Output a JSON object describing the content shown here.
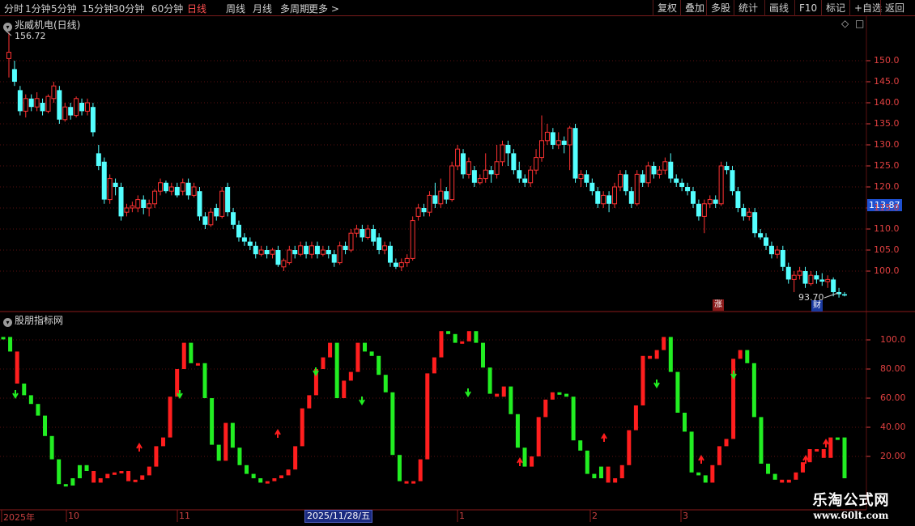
{
  "toolbar": {
    "left_items": [
      "分时",
      "1分钟",
      "5分钟",
      "15分钟",
      "30分钟",
      "60分钟",
      "日线",
      "周线",
      "月线",
      "多周期",
      "更多 >"
    ],
    "active": "日线",
    "right_items": [
      "复权",
      "叠加",
      "多股",
      "统计",
      "画线",
      "F10",
      "标记",
      "+自选",
      "返回"
    ]
  },
  "main_panel": {
    "title": "兆威机电(日线)",
    "high_label": "156.72",
    "low_label": "93.70",
    "price_tag": "113.87",
    "badge_up": "涨",
    "badge_cai": "财",
    "y_ticks": [
      "150.0",
      "145.0",
      "140.0",
      "135.0",
      "130.0",
      "125.0",
      "120.0",
      "115.0",
      "110.0",
      "105.0",
      "100.0"
    ]
  },
  "indicator_panel": {
    "title": "股朋指标网",
    "y_ticks": [
      "100.0",
      "80.00",
      "60.00",
      "40.00",
      "20.00"
    ]
  },
  "date_axis": {
    "labels": [
      "2025年",
      "10",
      "11",
      "1",
      "2",
      "3"
    ],
    "selected": "2025/11/28/五"
  },
  "watermark": {
    "title": "乐淘公式网",
    "url": "www.60lt.com"
  },
  "colors": {
    "up": "#ff3232",
    "down": "#54ffff",
    "ind_up": "#ff1e1e",
    "ind_down": "#22ee22",
    "grid": "#5a1010",
    "axis_text": "#e04040"
  },
  "chart_data": {
    "type": "candlestick",
    "candles": [
      [
        150.5,
        152.0,
        146.0,
        156.7
      ],
      [
        148.0,
        145.0,
        144.0,
        150.0
      ],
      [
        143.0,
        138.0,
        137.0,
        144.0
      ],
      [
        138.0,
        141.0,
        136.5,
        142.0
      ],
      [
        141.0,
        139.0,
        138.0,
        142.0
      ],
      [
        139.0,
        141.0,
        138.0,
        142.5
      ],
      [
        140.0,
        138.0,
        137.0,
        141.0
      ],
      [
        138.0,
        141.5,
        137.5,
        142.0
      ],
      [
        141.0,
        144.0,
        140.0,
        145.0
      ],
      [
        143.0,
        136.0,
        135.0,
        144.0
      ],
      [
        136.0,
        139.0,
        135.5,
        140.0
      ],
      [
        139.0,
        137.0,
        136.0,
        140.0
      ],
      [
        137.0,
        141.0,
        136.5,
        141.5
      ],
      [
        140.0,
        138.0,
        137.0,
        141.0
      ],
      [
        138.0,
        140.0,
        137.0,
        141.0
      ],
      [
        139.0,
        133.0,
        132.0,
        140.0
      ],
      [
        128.0,
        125.0,
        124.0,
        130.0
      ],
      [
        126.0,
        117.0,
        116.0,
        127.0
      ],
      [
        117.0,
        122.0,
        116.0,
        123.0
      ],
      [
        121.0,
        120.0,
        118.0,
        122.0
      ],
      [
        120.0,
        113.0,
        112.0,
        121.0
      ],
      [
        114.0,
        115.0,
        113.0,
        116.0
      ],
      [
        115.0,
        115.5,
        114.0,
        116.5
      ],
      [
        115.0,
        117.0,
        114.0,
        118.0
      ],
      [
        117.0,
        115.0,
        113.5,
        118.0
      ],
      [
        115.0,
        116.0,
        113.0,
        117.0
      ],
      [
        116.0,
        119.0,
        115.0,
        119.5
      ],
      [
        119.0,
        121.0,
        118.0,
        122.0
      ],
      [
        121.0,
        119.0,
        118.5,
        121.5
      ],
      [
        119.0,
        120.0,
        118.0,
        121.0
      ],
      [
        120.0,
        118.0,
        117.5,
        121.0
      ],
      [
        119.0,
        121.0,
        118.0,
        122.0
      ],
      [
        121.0,
        118.0,
        117.0,
        122.0
      ],
      [
        118.0,
        120.0,
        117.5,
        121.0
      ],
      [
        119.0,
        113.0,
        112.0,
        120.0
      ],
      [
        113.0,
        111.0,
        110.0,
        114.0
      ],
      [
        111.0,
        114.0,
        110.5,
        115.0
      ],
      [
        115.0,
        113.0,
        112.0,
        116.0
      ],
      [
        113.0,
        119.0,
        112.5,
        120.0
      ],
      [
        120.0,
        114.0,
        113.0,
        121.0
      ],
      [
        114.0,
        111.0,
        110.0,
        115.0
      ],
      [
        111.0,
        108.0,
        107.0,
        112.0
      ],
      [
        108.0,
        107.0,
        106.0,
        109.0
      ],
      [
        107.0,
        106.0,
        105.0,
        108.0
      ],
      [
        106.0,
        104.0,
        103.0,
        107.0
      ],
      [
        104.0,
        105.0,
        103.5,
        106.0
      ],
      [
        105.0,
        104.0,
        103.0,
        106.0
      ],
      [
        104.0,
        105.0,
        103.0,
        105.5
      ],
      [
        105.0,
        101.5,
        101.0,
        106.0
      ],
      [
        101.0,
        102.5,
        100.0,
        103.0
      ],
      [
        102.0,
        105.0,
        101.5,
        106.0
      ],
      [
        105.0,
        104.0,
        103.0,
        106.0
      ],
      [
        104.0,
        106.0,
        103.5,
        107.0
      ],
      [
        106.0,
        104.0,
        103.0,
        107.0
      ],
      [
        104.0,
        106.0,
        103.0,
        107.0
      ],
      [
        106.0,
        104.0,
        103.0,
        107.0
      ],
      [
        104.0,
        105.0,
        103.5,
        106.0
      ],
      [
        105.0,
        104.0,
        103.0,
        106.0
      ],
      [
        104.0,
        102.0,
        101.0,
        105.0
      ],
      [
        102.0,
        106.0,
        101.5,
        107.0
      ],
      [
        106.0,
        105.0,
        104.0,
        107.0
      ],
      [
        105.0,
        109.0,
        104.5,
        110.0
      ],
      [
        109.0,
        110.0,
        108.0,
        111.0
      ],
      [
        110.0,
        108.0,
        107.0,
        111.0
      ],
      [
        108.0,
        110.0,
        107.5,
        111.0
      ],
      [
        110.0,
        107.0,
        106.0,
        111.0
      ],
      [
        108.0,
        105.0,
        104.0,
        109.0
      ],
      [
        105.0,
        106.0,
        104.0,
        107.0
      ],
      [
        106.0,
        102.0,
        101.0,
        107.0
      ],
      [
        102.0,
        101.0,
        100.5,
        103.0
      ],
      [
        101.0,
        102.0,
        100.0,
        103.0
      ],
      [
        102.0,
        103.0,
        101.0,
        104.0
      ],
      [
        103.0,
        112.0,
        102.5,
        113.0
      ],
      [
        113.0,
        115.0,
        112.0,
        116.0
      ],
      [
        115.0,
        114.0,
        113.0,
        116.0
      ],
      [
        114.0,
        118.0,
        113.0,
        119.0
      ],
      [
        118.0,
        116.0,
        115.0,
        121.0
      ],
      [
        116.0,
        119.0,
        115.0,
        122.0
      ],
      [
        119.0,
        117.0,
        116.0,
        120.0
      ],
      [
        117.0,
        125.0,
        116.5,
        126.0
      ],
      [
        125.0,
        129.0,
        124.0,
        130.0
      ],
      [
        128.0,
        123.0,
        122.0,
        129.0
      ],
      [
        123.0,
        126.0,
        122.0,
        127.0
      ],
      [
        124.0,
        121.0,
        120.0,
        125.0
      ],
      [
        121.0,
        122.0,
        120.5,
        123.0
      ],
      [
        122.0,
        124.0,
        121.0,
        128.0
      ],
      [
        124.0,
        123.0,
        121.0,
        125.0
      ],
      [
        123.0,
        126.0,
        122.0,
        130.0
      ],
      [
        126.0,
        130.0,
        125.0,
        131.0
      ],
      [
        130.0,
        128.0,
        125.0,
        131.0
      ],
      [
        128.0,
        124.0,
        123.0,
        129.0
      ],
      [
        124.0,
        122.0,
        121.0,
        126.0
      ],
      [
        122.0,
        121.0,
        120.0,
        123.0
      ],
      [
        121.0,
        124.0,
        120.0,
        125.0
      ],
      [
        124.0,
        127.0,
        123.0,
        129.0
      ],
      [
        127.0,
        131.0,
        126.0,
        137.0
      ],
      [
        131.0,
        133.0,
        130.0,
        135.0
      ],
      [
        133.0,
        130.0,
        129.0,
        134.0
      ],
      [
        130.0,
        131.0,
        129.0,
        133.0
      ],
      [
        131.0,
        130.0,
        128.0,
        132.0
      ],
      [
        130.0,
        134.0,
        124.0,
        134.5
      ],
      [
        134.0,
        122.0,
        121.0,
        135.0
      ],
      [
        122.0,
        123.0,
        120.0,
        124.0
      ],
      [
        123.0,
        121.0,
        120.0,
        124.0
      ],
      [
        121.0,
        119.0,
        118.0,
        122.0
      ],
      [
        119.0,
        116.0,
        115.0,
        120.0
      ],
      [
        116.0,
        118.0,
        115.0,
        119.0
      ],
      [
        118.0,
        116.0,
        114.0,
        119.0
      ],
      [
        116.0,
        120.0,
        115.0,
        121.0
      ],
      [
        120.0,
        123.0,
        119.0,
        124.0
      ],
      [
        123.0,
        119.0,
        118.0,
        124.0
      ],
      [
        119.0,
        116.0,
        115.0,
        120.0
      ],
      [
        116.0,
        123.0,
        115.5,
        124.0
      ],
      [
        123.0,
        121.0,
        120.0,
        124.0
      ],
      [
        121.0,
        125.0,
        120.0,
        126.0
      ],
      [
        125.0,
        123.0,
        122.0,
        126.0
      ],
      [
        123.0,
        124.0,
        122.0,
        125.0
      ],
      [
        124.0,
        126.0,
        123.0,
        127.0
      ],
      [
        126.0,
        122.0,
        121.0,
        128.0
      ],
      [
        122.0,
        121.0,
        120.0,
        123.0
      ],
      [
        121.0,
        120.0,
        119.0,
        122.0
      ],
      [
        120.0,
        119.0,
        118.0,
        121.0
      ],
      [
        119.0,
        116.0,
        115.0,
        120.0
      ],
      [
        116.0,
        113.0,
        112.0,
        117.0
      ],
      [
        113.0,
        116.0,
        109.0,
        117.0
      ],
      [
        116.0,
        117.0,
        115.0,
        118.0
      ],
      [
        117.0,
        116.0,
        115.0,
        118.0
      ],
      [
        116.0,
        125.0,
        115.5,
        126.0
      ],
      [
        125.0,
        124.0,
        123.0,
        126.0
      ],
      [
        124.0,
        119.0,
        118.0,
        125.0
      ],
      [
        119.0,
        115.0,
        114.0,
        120.0
      ],
      [
        115.0,
        113.0,
        112.0,
        116.0
      ],
      [
        113.0,
        114.0,
        112.0,
        115.0
      ],
      [
        114.0,
        109.0,
        108.0,
        115.0
      ],
      [
        109.0,
        108.0,
        107.5,
        110.0
      ],
      [
        108.0,
        106.0,
        105.0,
        109.0
      ],
      [
        106.0,
        104.0,
        103.0,
        107.0
      ],
      [
        104.0,
        105.0,
        103.0,
        106.0
      ],
      [
        105.0,
        101.0,
        100.0,
        106.0
      ],
      [
        101.0,
        98.0,
        97.0,
        102.0
      ],
      [
        98.0,
        99.0,
        95.0,
        100.0
      ],
      [
        99.0,
        100.0,
        98.0,
        101.0
      ],
      [
        100.0,
        97.0,
        96.0,
        101.0
      ],
      [
        97.0,
        99.0,
        96.5,
        100.0
      ],
      [
        99.0,
        98.0,
        97.0,
        100.0
      ],
      [
        98.0,
        97.5,
        96.5,
        99.5
      ],
      [
        97.5,
        98.0,
        96.0,
        99.0
      ],
      [
        98.0,
        95.0,
        94.0,
        98.5
      ],
      [
        95.0,
        94.5,
        93.7,
        96.0
      ],
      [
        94.5,
        94.2,
        94.0,
        95.0
      ]
    ],
    "indicator": [
      [
        102,
        0
      ],
      [
        92,
        0
      ],
      [
        70,
        1
      ],
      [
        62,
        0
      ],
      [
        56,
        0
      ],
      [
        48,
        0
      ],
      [
        34,
        0
      ],
      [
        18,
        0
      ],
      [
        1,
        0
      ],
      [
        0,
        0
      ],
      [
        5,
        0
      ],
      [
        14,
        0
      ],
      [
        10,
        0
      ],
      [
        2,
        1
      ],
      [
        5,
        1
      ],
      [
        8,
        1
      ],
      [
        9,
        1
      ],
      [
        10,
        1
      ],
      [
        3,
        1
      ],
      [
        4,
        1
      ],
      [
        7,
        1
      ],
      [
        13,
        1
      ],
      [
        27,
        1
      ],
      [
        33,
        1
      ],
      [
        61,
        1
      ],
      [
        80,
        1
      ],
      [
        98,
        1
      ],
      [
        84,
        0
      ],
      [
        84,
        1
      ],
      [
        60,
        0
      ],
      [
        28,
        0
      ],
      [
        17,
        0
      ],
      [
        43,
        1
      ],
      [
        26,
        0
      ],
      [
        14,
        0
      ],
      [
        8,
        0
      ],
      [
        5,
        0
      ],
      [
        2,
        0
      ],
      [
        3,
        1
      ],
      [
        5,
        1
      ],
      [
        7,
        1
      ],
      [
        11,
        1
      ],
      [
        27,
        1
      ],
      [
        53,
        1
      ],
      [
        62,
        1
      ],
      [
        80,
        1
      ],
      [
        88,
        1
      ],
      [
        98,
        1
      ],
      [
        60,
        0
      ],
      [
        72,
        1
      ],
      [
        78,
        1
      ],
      [
        98,
        1
      ],
      [
        92,
        0
      ],
      [
        89,
        0
      ],
      [
        76,
        0
      ],
      [
        64,
        0
      ],
      [
        21,
        0
      ],
      [
        3,
        0
      ],
      [
        3,
        1
      ],
      [
        3,
        1
      ],
      [
        18,
        1
      ],
      [
        77,
        1
      ],
      [
        88,
        1
      ],
      [
        106,
        1
      ],
      [
        104,
        0
      ],
      [
        98,
        0
      ],
      [
        99,
        1
      ],
      [
        106,
        1
      ],
      [
        98,
        0
      ],
      [
        81,
        0
      ],
      [
        63,
        0
      ],
      [
        61,
        1
      ],
      [
        68,
        1
      ],
      [
        49,
        0
      ],
      [
        26,
        0
      ],
      [
        13,
        0
      ],
      [
        20,
        1
      ],
      [
        47,
        1
      ],
      [
        59,
        1
      ],
      [
        64,
        1
      ],
      [
        63,
        0
      ],
      [
        61,
        0
      ],
      [
        31,
        0
      ],
      [
        24,
        0
      ],
      [
        8,
        0
      ],
      [
        5,
        0
      ],
      [
        13,
        0
      ],
      [
        2,
        1
      ],
      [
        5,
        1
      ],
      [
        14,
        1
      ],
      [
        38,
        1
      ],
      [
        55,
        1
      ],
      [
        89,
        1
      ],
      [
        87,
        1
      ],
      [
        93,
        1
      ],
      [
        102,
        1
      ],
      [
        78,
        0
      ],
      [
        50,
        0
      ],
      [
        37,
        0
      ],
      [
        9,
        0
      ],
      [
        7,
        0
      ],
      [
        2,
        0
      ],
      [
        14,
        1
      ],
      [
        27,
        1
      ],
      [
        32,
        1
      ],
      [
        87,
        1
      ],
      [
        93,
        1
      ],
      [
        84,
        0
      ],
      [
        47,
        0
      ],
      [
        15,
        0
      ],
      [
        8,
        0
      ],
      [
        4,
        0
      ],
      [
        2,
        1
      ],
      [
        4,
        1
      ],
      [
        9,
        1
      ],
      [
        16,
        1
      ],
      [
        25,
        1
      ],
      [
        25,
        1
      ],
      [
        19,
        1
      ],
      [
        33,
        1
      ],
      [
        33,
        0
      ],
      [
        5,
        0
      ]
    ]
  }
}
